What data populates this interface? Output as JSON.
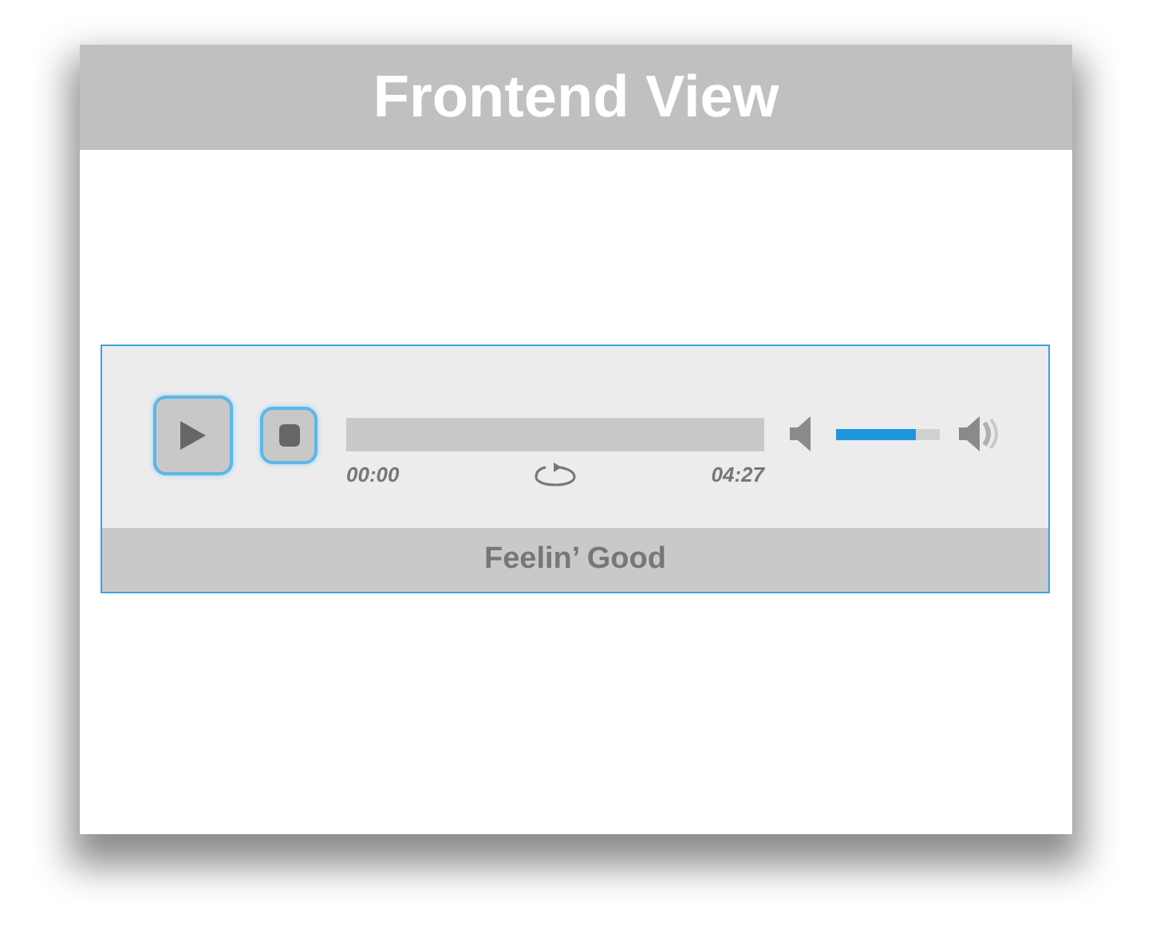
{
  "window": {
    "title": "Frontend View"
  },
  "player": {
    "elapsed": "00:00",
    "duration": "04:27",
    "volume": {
      "level": 0.77
    },
    "track_title": "Feelin’ Good"
  }
}
